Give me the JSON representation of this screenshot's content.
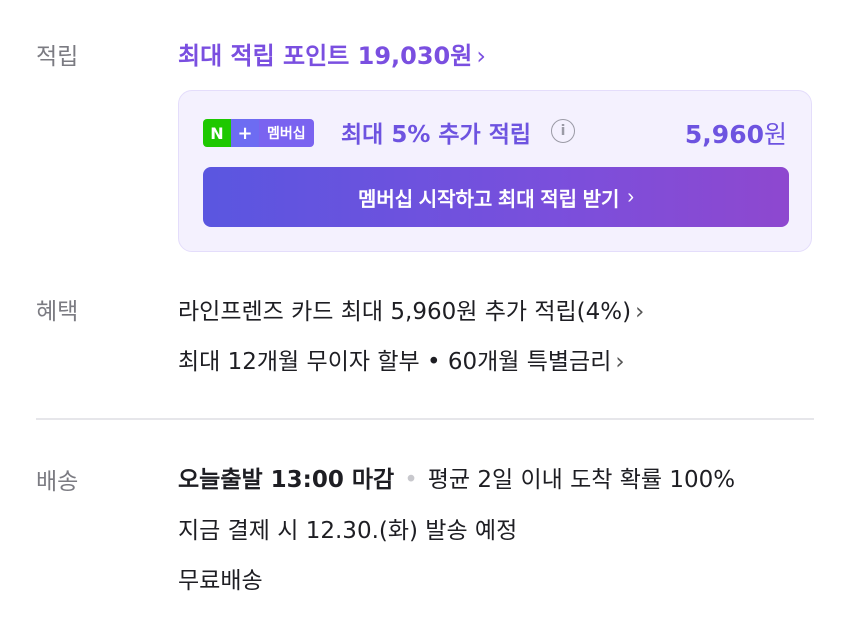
{
  "accrual": {
    "label": "적립",
    "max_points_text": "최대 적립 포인트 19,030원",
    "promo": {
      "badge_n": "N",
      "badge_plus": "+",
      "badge_membership": "멤버십",
      "extra_text": "최대 5% 추가 적립",
      "info_icon": "info-icon",
      "amount_value": "5,960",
      "amount_unit": "원",
      "cta_label": "멤버십 시작하고 최대 적립 받기"
    }
  },
  "benefits": {
    "label": "혜택",
    "line1": "라인프렌즈 카드 최대 5,960원 추가 적립(4%)",
    "line2": "최대 12개월 무이자 할부 • 60개월 특별금리"
  },
  "shipping": {
    "label": "배송",
    "today_departure": "오늘출발 13:00 마감",
    "arrival_info": "평균 2일 이내 도착 확률 100%",
    "schedule": "지금 결제 시 12.30.(화) 발송 예정",
    "fee": "무료배송"
  },
  "colors": {
    "accent_purple": "#7a4fe0",
    "promo_bg": "#f4f1fe",
    "naver_green": "#1ec800"
  }
}
